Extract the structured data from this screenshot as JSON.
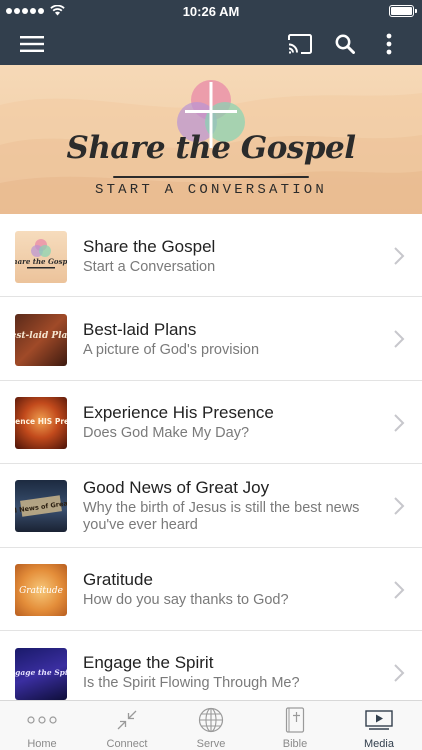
{
  "status_bar": {
    "time": "10:26 AM"
  },
  "nav": {
    "icons": [
      "hamburger-menu-icon",
      "cast-icon",
      "search-icon",
      "more-vertical-icon"
    ]
  },
  "banner": {
    "title": "Share the Gospel",
    "subtitle": "START A CONVERSATION",
    "colors": {
      "pink": "#e88aa8",
      "purple": "#b994d4",
      "green": "#86d4b4"
    }
  },
  "items": [
    {
      "title": "Share the Gospel",
      "subtitle": "Start a Conversation",
      "thumb_text": "Share the Gospel"
    },
    {
      "title": "Best-laid Plans",
      "subtitle": "A picture of God's provision",
      "thumb_text": "Best-laid Plans"
    },
    {
      "title": "Experience His Presence",
      "subtitle": "Does God Make My Day?",
      "thumb_text": "Experience HIS Presence"
    },
    {
      "title": "Good News of Great Joy",
      "subtitle": "Why the birth of Jesus is still the best news you've ever heard",
      "thumb_text": "Good News of Great Joy"
    },
    {
      "title": "Gratitude",
      "subtitle": "How do you say thanks to God?",
      "thumb_text": "Gratitude"
    },
    {
      "title": "Engage the Spirit",
      "subtitle": "Is the Spirit Flowing Through Me?",
      "thumb_text": "Engage the Spirit"
    }
  ],
  "tabs": [
    {
      "label": "Home",
      "icon": "home-dots-icon",
      "active": false
    },
    {
      "label": "Connect",
      "icon": "connect-arrows-icon",
      "active": false
    },
    {
      "label": "Serve",
      "icon": "globe-icon",
      "active": false
    },
    {
      "label": "Bible",
      "icon": "bible-icon",
      "active": false
    },
    {
      "label": "Media",
      "icon": "media-play-icon",
      "active": true
    }
  ],
  "theme": {
    "nav_color": "#323f4d",
    "active_tab_color": "#323f4d"
  }
}
